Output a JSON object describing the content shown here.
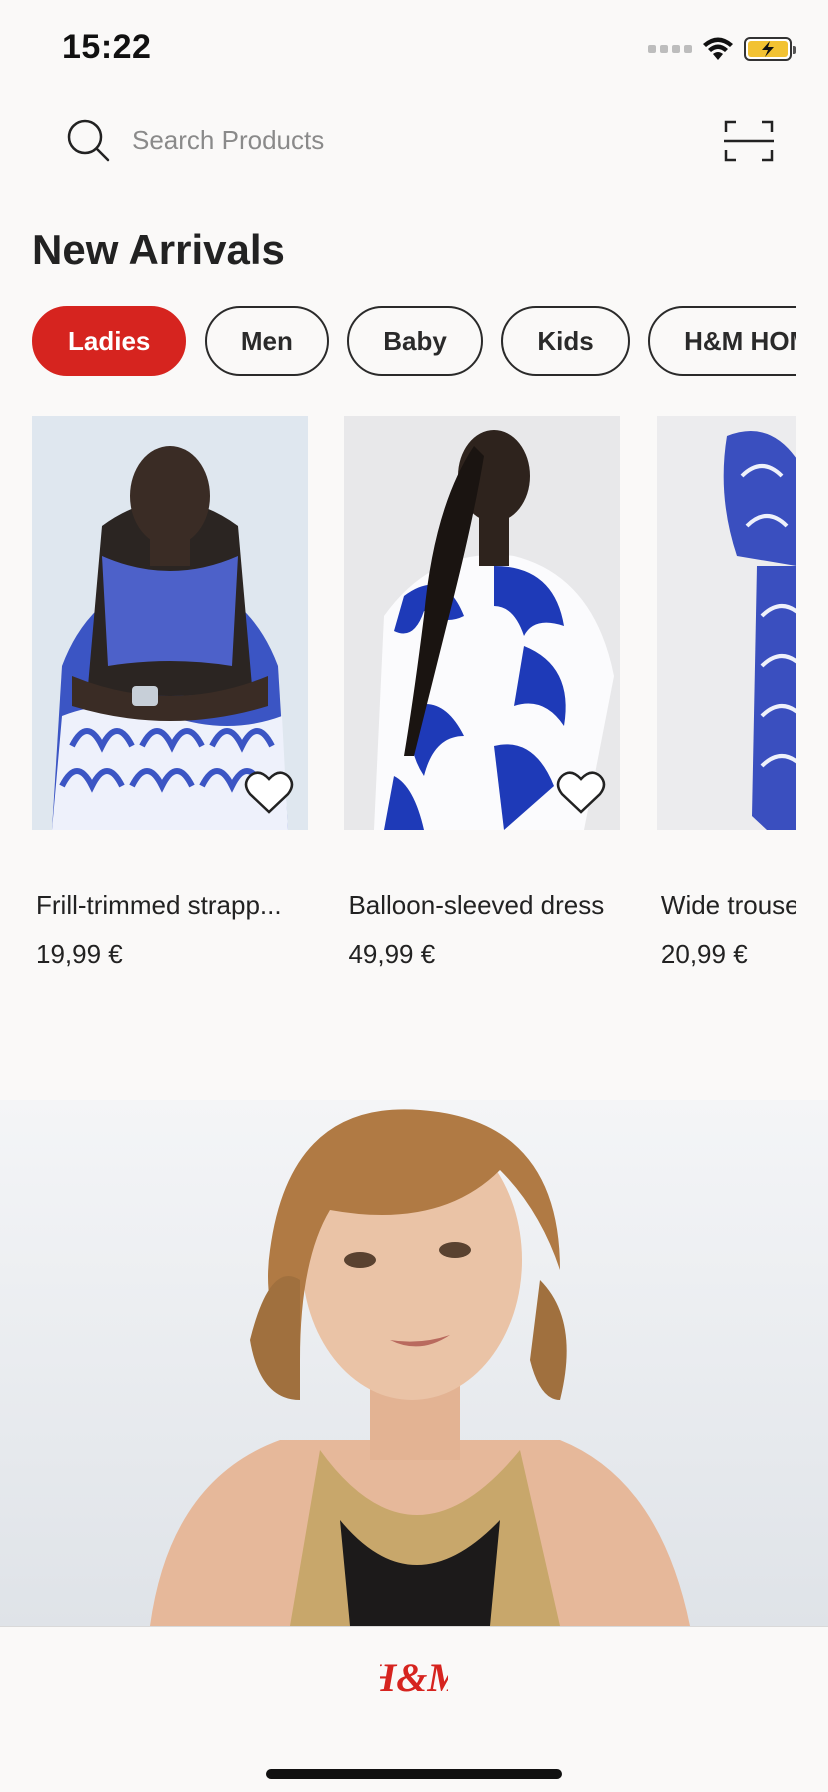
{
  "status_bar": {
    "time": "15:22"
  },
  "search": {
    "placeholder": "Search Products"
  },
  "section": {
    "title": "New Arrivals"
  },
  "categories": [
    {
      "label": "Ladies",
      "active": true
    },
    {
      "label": "Men",
      "active": false
    },
    {
      "label": "Baby",
      "active": false
    },
    {
      "label": "Kids",
      "active": false
    },
    {
      "label": "H&M HOME",
      "active": false
    }
  ],
  "products": [
    {
      "name": "Frill-trimmed strapp...",
      "price": "19,99 €"
    },
    {
      "name": "Balloon-sleeved dress",
      "price": "49,99 €"
    },
    {
      "name": "Wide trousers",
      "price": "20,99 €"
    }
  ],
  "brand": {
    "logo_text": "H&M",
    "accent_color": "#d6241f"
  },
  "icons": [
    "search-icon",
    "scan-icon",
    "heart-icon",
    "wifi-icon",
    "battery-icon"
  ]
}
